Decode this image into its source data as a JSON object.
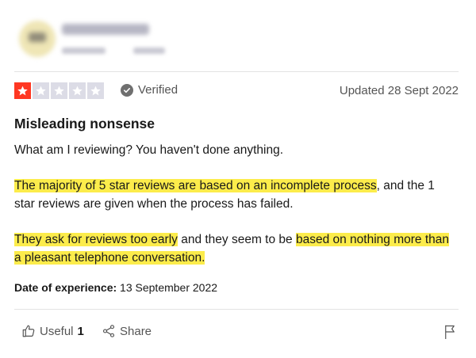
{
  "rating": {
    "value": 1,
    "max": 5,
    "filled_color": "#ff3722",
    "empty_color": "#dcdce6"
  },
  "verified_label": "Verified",
  "updated_label": "Updated 28 Sept 2022",
  "title": "Misleading nonsense",
  "body": {
    "p1": "What am I reviewing? You haven't done anything.",
    "p2_hl1": "The majority of 5 star reviews are based on an incomplete process",
    "p2_rest": ", and the 1 star reviews are given when the process has failed.",
    "p3_hl1": "They ask for reviews too early",
    "p3_mid": " and they seem to be ",
    "p3_hl2": "based on nothing more than a pleasant telephone conversation."
  },
  "experience": {
    "label": "Date of experience:",
    "value": " 13 September 2022"
  },
  "actions": {
    "useful_label": "Useful",
    "useful_count": "1",
    "share_label": "Share"
  },
  "icons": {
    "verified": "check-circle-icon",
    "useful": "thumbs-up-icon",
    "share": "share-icon",
    "report": "flag-icon"
  },
  "highlight_color": "#fcec4b"
}
